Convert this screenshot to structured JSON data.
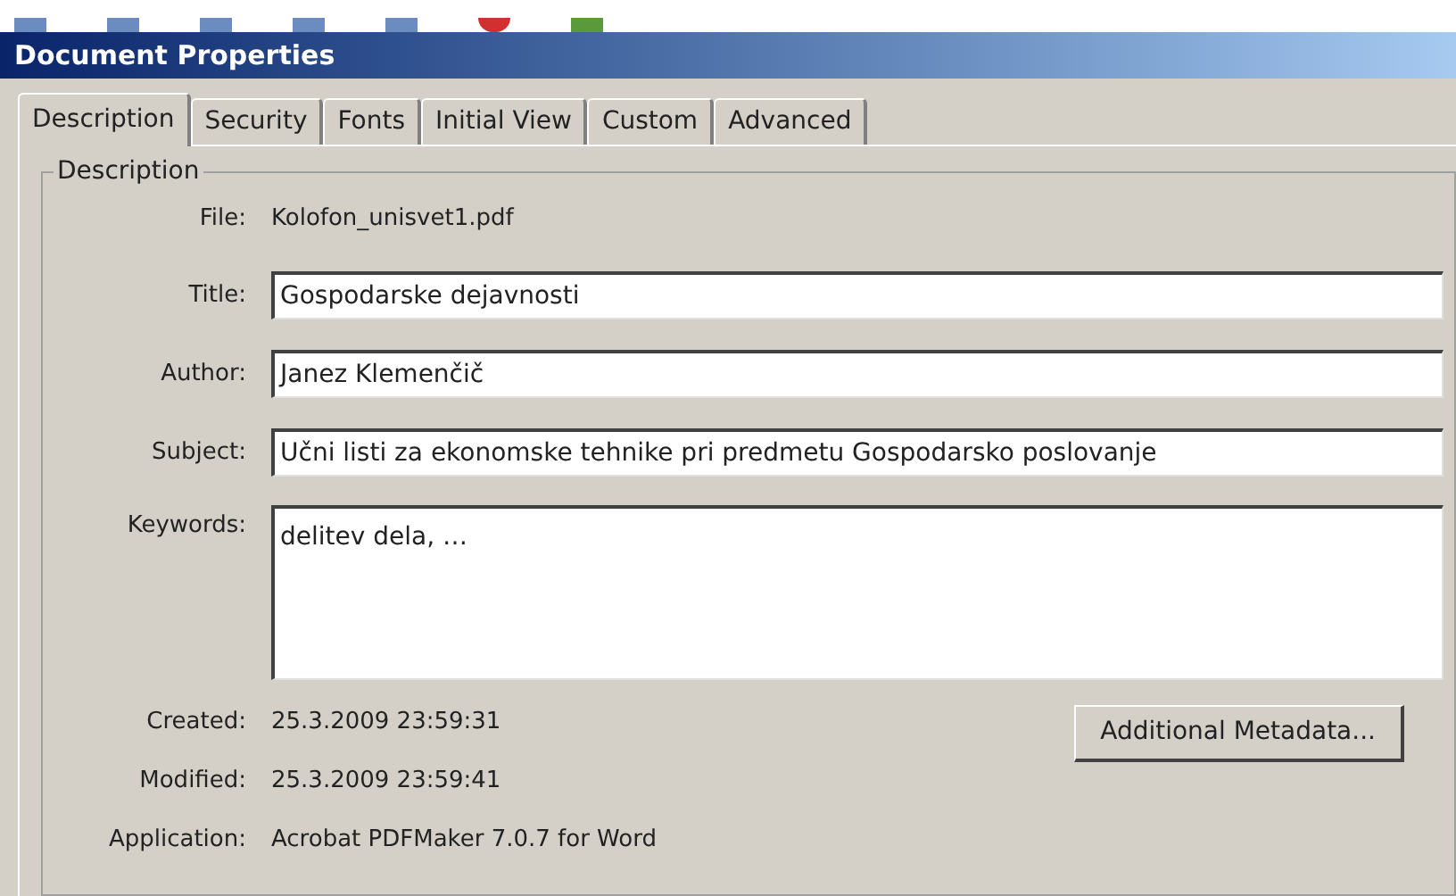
{
  "window": {
    "title": "Document Properties"
  },
  "tabs": [
    {
      "label": "Description",
      "selected": true
    },
    {
      "label": "Security",
      "selected": false
    },
    {
      "label": "Fonts",
      "selected": false
    },
    {
      "label": "Initial View",
      "selected": false
    },
    {
      "label": "Custom",
      "selected": false
    },
    {
      "label": "Advanced",
      "selected": false
    }
  ],
  "group": {
    "title": "Description"
  },
  "file": {
    "label": "File:",
    "value": "Kolofon_unisvet1.pdf"
  },
  "fields": [
    {
      "label": "Title:",
      "value": "Gospodarske dejavnosti"
    },
    {
      "label": "Author:",
      "value": "Janez Klemenčič"
    },
    {
      "label": "Subject:",
      "value": "Učni listi za ekonomske tehnike pri predmetu Gospodarsko poslovanje"
    }
  ],
  "keywords": {
    "label": "Keywords:",
    "value": "delitev dela, …"
  },
  "info": [
    {
      "label": "Created:",
      "value": "25.3.2009 23:59:31"
    },
    {
      "label": "Modified:",
      "value": "25.3.2009 23:59:41"
    },
    {
      "label": "Application:",
      "value": "Acrobat PDFMaker 7.0.7 for Word"
    }
  ],
  "metadata_button": "Additional Metadata..."
}
